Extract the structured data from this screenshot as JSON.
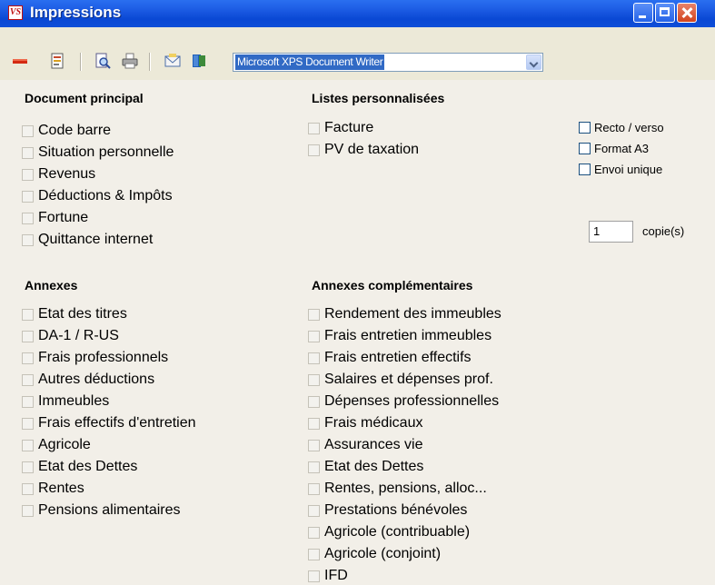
{
  "window": {
    "title": "Impressions",
    "app_icon_text": "VS"
  },
  "toolbar": {
    "icons": [
      "minus-icon",
      "document-icon",
      "print-preview-icon",
      "printer-icon",
      "envelope-icon",
      "exit-icon"
    ],
    "printer": {
      "selected": "Microsoft XPS Document Writer"
    }
  },
  "sections": {
    "document_principal": {
      "title": "Document principal",
      "items": [
        "Code barre",
        "Situation personnelle",
        "Revenus",
        "Déductions & Impôts",
        "Fortune",
        "Quittance internet"
      ]
    },
    "listes_personnalisees": {
      "title": "Listes personnalisées",
      "items": [
        "Facture",
        "PV de taxation"
      ]
    },
    "annexes": {
      "title": "Annexes",
      "items": [
        "Etat des titres",
        "DA-1 / R-US",
        "Frais professionnels",
        "Autres déductions",
        "Immeubles",
        "Frais effectifs d'entretien",
        "Agricole",
        "Etat des Dettes",
        "Rentes",
        "Pensions alimentaires"
      ]
    },
    "annexes_complementaires": {
      "title": "Annexes complémentaires",
      "items": [
        "Rendement des immeubles",
        "Frais entretien immeubles",
        "Frais entretien effectifs",
        "Salaires et dépenses prof.",
        "Dépenses professionnelles",
        "Frais médicaux",
        "Assurances vie",
        "Etat des Dettes",
        "Rentes, pensions, alloc...",
        "Prestations bénévoles",
        "Agricole (contribuable)",
        "Agricole (conjoint)",
        "IFD"
      ]
    }
  },
  "options": {
    "recto_verso": "Recto / verso",
    "format_a3": "Format A3",
    "envoi_unique": "Envoi unique",
    "copies_value": "1",
    "copies_label": "copie(s)"
  }
}
